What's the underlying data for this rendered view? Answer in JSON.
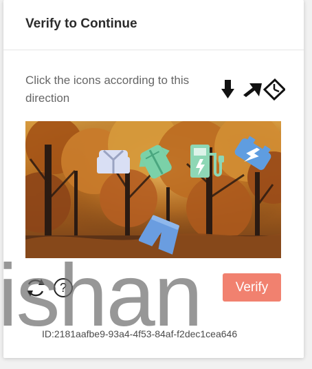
{
  "dialog": {
    "title": "Verify to Continue",
    "instruction": "Click the icons according to this direction",
    "order_icons": [
      "down-arrow-icon",
      "up-right-arrow-icon",
      "clock-icon"
    ],
    "puzzle_icons": [
      "jacket-icon",
      "clothing-icon",
      "ev-charging-station-icon",
      "car-battery-icon",
      "shorts-icon"
    ],
    "refresh_icon": "refresh-icon",
    "help_icon": "help-icon",
    "verify_label": "Verify",
    "id_text": "ID:2181aafbe9-93a4-4f53-84af-f2dec1cea646"
  },
  "watermark": {
    "text": "ishan"
  },
  "colors": {
    "verify_button": "#f1816f",
    "background": "#f1f1f1",
    "card": "#ffffff",
    "title": "#2b2b2b",
    "instruction": "#666666"
  }
}
